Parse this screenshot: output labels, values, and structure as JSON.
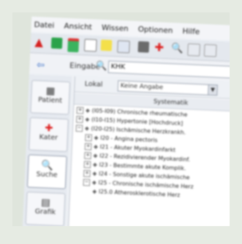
{
  "menu": [
    "Datei",
    "Ansicht",
    "Wissen",
    "Optionen",
    "Hilfe"
  ],
  "address": {
    "label": "Eingabe",
    "value": "KHK"
  },
  "sidebar": [
    {
      "label": "Patient",
      "icon": "patient-icon"
    },
    {
      "label": "Kater",
      "icon": "plus-icon"
    },
    {
      "label": "Suche",
      "icon": "search-icon"
    },
    {
      "label": "Grafik",
      "icon": "chart-icon"
    }
  ],
  "filter": {
    "label": "Lokal",
    "select": "Keine Angabe"
  },
  "column_header": "Systematik",
  "tree": [
    {
      "indent": 0,
      "expander": "+",
      "text": "(I05-I09) Chronische rheumatische"
    },
    {
      "indent": 0,
      "expander": "+",
      "text": "(I10-I15) Hypertonie [Hochdruck]"
    },
    {
      "indent": 0,
      "expander": "−",
      "text": "(I20-I25) Ischämische Herzkrankh."
    },
    {
      "indent": 1,
      "expander": "+",
      "text": "I20 - Angina pectoris"
    },
    {
      "indent": 1,
      "expander": "+",
      "text": "I21 - Akuter Myokardinfarkt"
    },
    {
      "indent": 1,
      "expander": "+",
      "text": "I22 - Rezidivierender Myokardinf."
    },
    {
      "indent": 1,
      "expander": "+",
      "text": "I23 - Bestimmte akute Komplik."
    },
    {
      "indent": 1,
      "expander": "+",
      "text": "I24 - Sonstige akute ischämische"
    },
    {
      "indent": 1,
      "expander": "−",
      "text": "I25 - Chronische ischämische Herz"
    },
    {
      "indent": 2,
      "expander": "",
      "text": "I25.0 Atherosklerotische Herz"
    }
  ]
}
